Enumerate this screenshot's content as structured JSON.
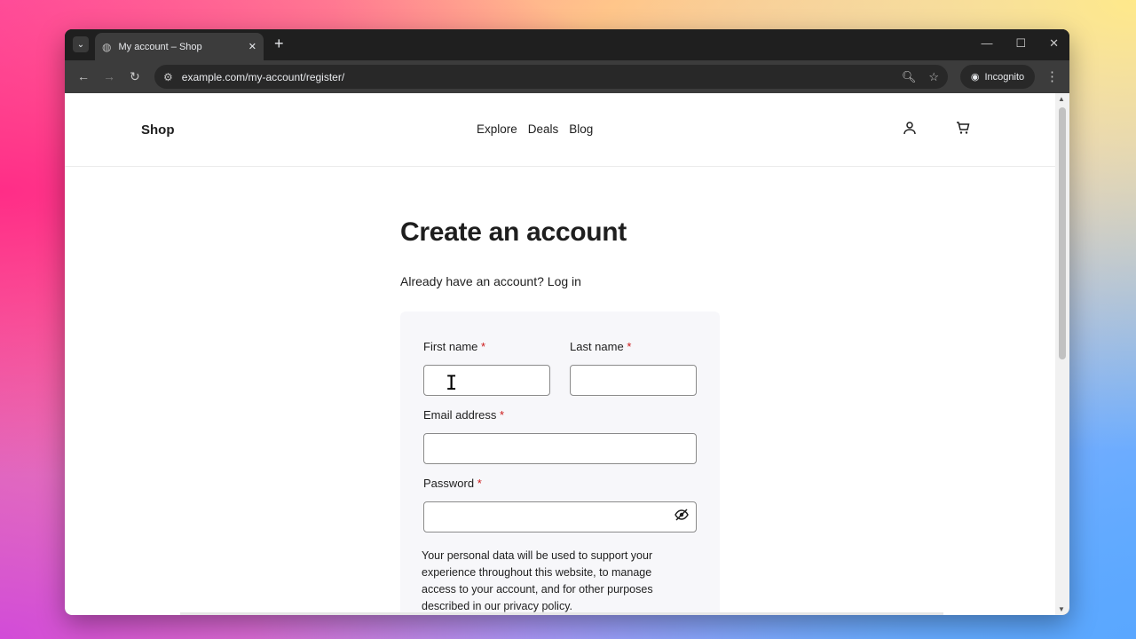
{
  "browser": {
    "tab_title": "My account – Shop",
    "new_tab_symbol": "+",
    "url": "example.com/my-account/register/",
    "incognito_label": "Incognito"
  },
  "site": {
    "logo": "Shop",
    "nav": [
      "Explore",
      "Deals",
      "Blog"
    ]
  },
  "page": {
    "title": "Create an account",
    "login_prompt": "Already have an account? Log in"
  },
  "form": {
    "first_name_label": "First name",
    "last_name_label": "Last name",
    "email_label": "Email address",
    "password_label": "Password",
    "required_mark": "*",
    "first_name_value": "",
    "last_name_value": "",
    "email_value": "",
    "password_value": "",
    "privacy_note": "Your personal data will be used to support your experience throughout this website, to manage access to your account, and for other purposes described in our privacy policy."
  },
  "icons": {
    "tab_menu": "chevron-down-icon",
    "globe": "globe-icon",
    "account": "user-icon",
    "cart": "cart-icon",
    "password_toggle": "eye-off-icon"
  }
}
